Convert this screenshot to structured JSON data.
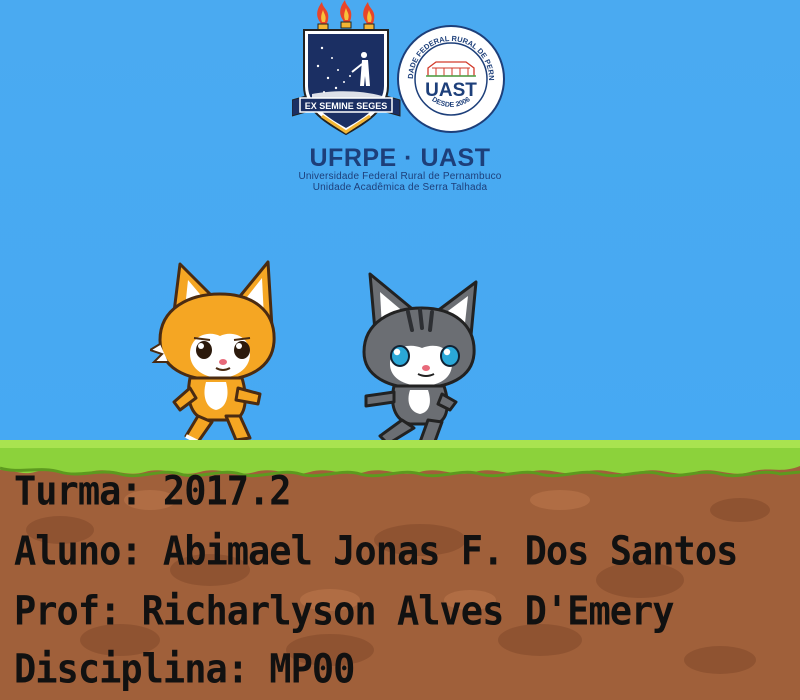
{
  "logo": {
    "motto": "EX SEMINE SEGES",
    "seal_center": "UAST",
    "seal_ring_top": "UNIVERSIDADE FEDERAL RURAL DE PERNAMBUCO",
    "seal_ring_bottom": "DESDE 2006",
    "title": "UFRPE · UAST",
    "subtitle_1": "Universidade Federal Rural de Pernambuco",
    "subtitle_2": "Unidade Acadêmica de Serra Talhada"
  },
  "info": {
    "line1": "Turma: 2017.2",
    "line2": "Aluno: Abimael Jonas F. Dos Santos",
    "line3": "Prof: Richarlyson Alves D'Emery",
    "line4": "Disciplina: MP00"
  },
  "characters": [
    {
      "name": "orange-fox-character",
      "color": "#f5a623"
    },
    {
      "name": "gray-cat-character",
      "color": "#6b6e73"
    }
  ],
  "colors": {
    "sky": "#45a9f3",
    "grass": "#8cd23b",
    "dirt": "#a0603a",
    "logo_blue": "#1d3f7a",
    "flame": "#e8452a"
  }
}
